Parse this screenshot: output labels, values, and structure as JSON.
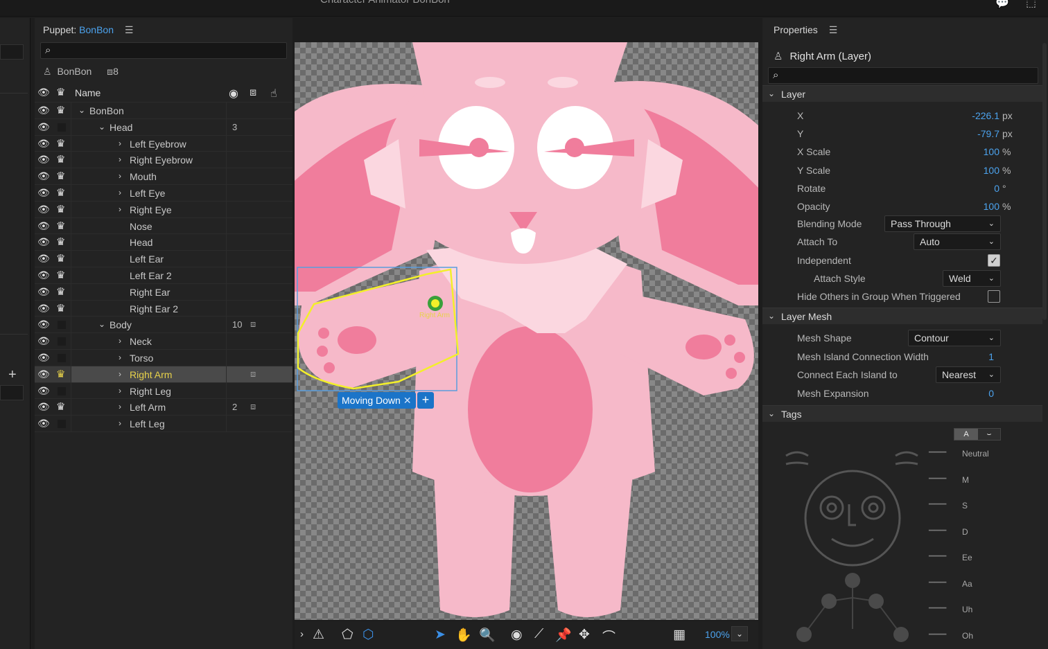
{
  "app": {
    "title": "Character Animator BonBon"
  },
  "puppet_panel": {
    "label": "Puppet:",
    "puppet_name": "BonBon",
    "search_placeholder": "",
    "info_name": "BonBon",
    "info_count": "8",
    "column_name": "Name",
    "layers": [
      {
        "name": "BonBon",
        "depth": 0,
        "expanded": true,
        "chev": "⌄",
        "crown": true,
        "num": "",
        "cam": false
      },
      {
        "name": "Head",
        "depth": 1,
        "expanded": true,
        "chev": "⌄",
        "crown": false,
        "num": "3",
        "cam": false
      },
      {
        "name": "Left Eyebrow",
        "depth": 2,
        "chev": "›",
        "crown": true,
        "num": "",
        "cam": false
      },
      {
        "name": "Right Eyebrow",
        "depth": 2,
        "chev": "›",
        "crown": true,
        "num": "",
        "cam": false
      },
      {
        "name": "Mouth",
        "depth": 2,
        "chev": "›",
        "crown": true,
        "num": "",
        "cam": false
      },
      {
        "name": "Left Eye",
        "depth": 2,
        "chev": "›",
        "crown": true,
        "num": "",
        "cam": false
      },
      {
        "name": "Right Eye",
        "depth": 2,
        "chev": "›",
        "crown": true,
        "num": "",
        "cam": false
      },
      {
        "name": "Nose",
        "depth": 2,
        "chev": "",
        "crown": true,
        "num": "",
        "cam": false
      },
      {
        "name": "Head",
        "depth": 2,
        "chev": "",
        "crown": true,
        "num": "",
        "cam": false
      },
      {
        "name": "Left Ear",
        "depth": 2,
        "chev": "",
        "crown": true,
        "num": "",
        "cam": false
      },
      {
        "name": "Left Ear 2",
        "depth": 2,
        "chev": "",
        "crown": true,
        "num": "",
        "cam": false
      },
      {
        "name": "Right Ear",
        "depth": 2,
        "chev": "",
        "crown": true,
        "num": "",
        "cam": false
      },
      {
        "name": "Right Ear 2",
        "depth": 2,
        "chev": "",
        "crown": true,
        "num": "",
        "cam": false
      },
      {
        "name": "Body",
        "depth": 1,
        "chev": "⌄",
        "crown": false,
        "num": "10",
        "cam": true
      },
      {
        "name": "Neck",
        "depth": 2,
        "chev": "›",
        "crown": false,
        "num": "",
        "cam": false
      },
      {
        "name": "Torso",
        "depth": 2,
        "chev": "›",
        "crown": false,
        "num": "",
        "cam": false
      },
      {
        "name": "Right Arm",
        "depth": 2,
        "chev": "›",
        "crown": true,
        "crown_yellow": true,
        "selected": true,
        "num": "",
        "cam": true
      },
      {
        "name": "Right Leg",
        "depth": 2,
        "chev": "›",
        "crown": false,
        "num": "",
        "cam": false
      },
      {
        "name": "Left Arm",
        "depth": 2,
        "chev": "›",
        "crown": true,
        "num": "2",
        "cam": true
      },
      {
        "name": "Left Leg",
        "depth": 2,
        "chev": "›",
        "crown": false,
        "num": "",
        "cam": false
      }
    ]
  },
  "canvas": {
    "handle_label": "Right Arm",
    "tag_label": "Moving Down",
    "tag_close": "✕",
    "tag_add": "+",
    "zoom": "100%"
  },
  "properties": {
    "header": "Properties",
    "title": "Right Arm (Layer)",
    "sections": {
      "layer": "Layer",
      "layer_mesh": "Layer Mesh",
      "tags": "Tags"
    },
    "layer_props": [
      {
        "label": "X",
        "value": "-226.1",
        "unit": "px"
      },
      {
        "label": "Y",
        "value": "-79.7",
        "unit": "px"
      },
      {
        "label": "X Scale",
        "value": "100",
        "unit": "%"
      },
      {
        "label": "Y Scale",
        "value": "100",
        "unit": "%"
      },
      {
        "label": "Rotate",
        "value": "0",
        "unit": "°"
      },
      {
        "label": "Opacity",
        "value": "100",
        "unit": "%"
      }
    ],
    "blending_mode": {
      "label": "Blending Mode",
      "value": "Pass Through"
    },
    "attach_to": {
      "label": "Attach To",
      "value": "Auto"
    },
    "independent": {
      "label": "Independent",
      "checked": true
    },
    "attach_style": {
      "label": "Attach Style",
      "value": "Weld"
    },
    "hide_others": {
      "label": "Hide Others in Group When Triggered",
      "checked": false
    },
    "mesh": {
      "mesh_shape": {
        "label": "Mesh Shape",
        "value": "Contour"
      },
      "island_width": {
        "label": "Mesh Island Connection Width",
        "value": "1"
      },
      "connect_each": {
        "label": "Connect Each Island to",
        "value": "Nearest"
      },
      "expansion": {
        "label": "Mesh Expansion",
        "value": "0"
      }
    },
    "tags_toggle": {
      "a": "A",
      "b": "⌣"
    },
    "visemes": [
      "Neutral",
      "M",
      "S",
      "D",
      "Ee",
      "Aa",
      "Uh",
      "Oh"
    ]
  },
  "colors": {
    "accent": "#4ca3ee",
    "selected_text": "#e8d24a",
    "tag_blue": "#1b74c8",
    "bunny_pink": "#f6b9c9",
    "bunny_dark": "#f07d9c"
  }
}
